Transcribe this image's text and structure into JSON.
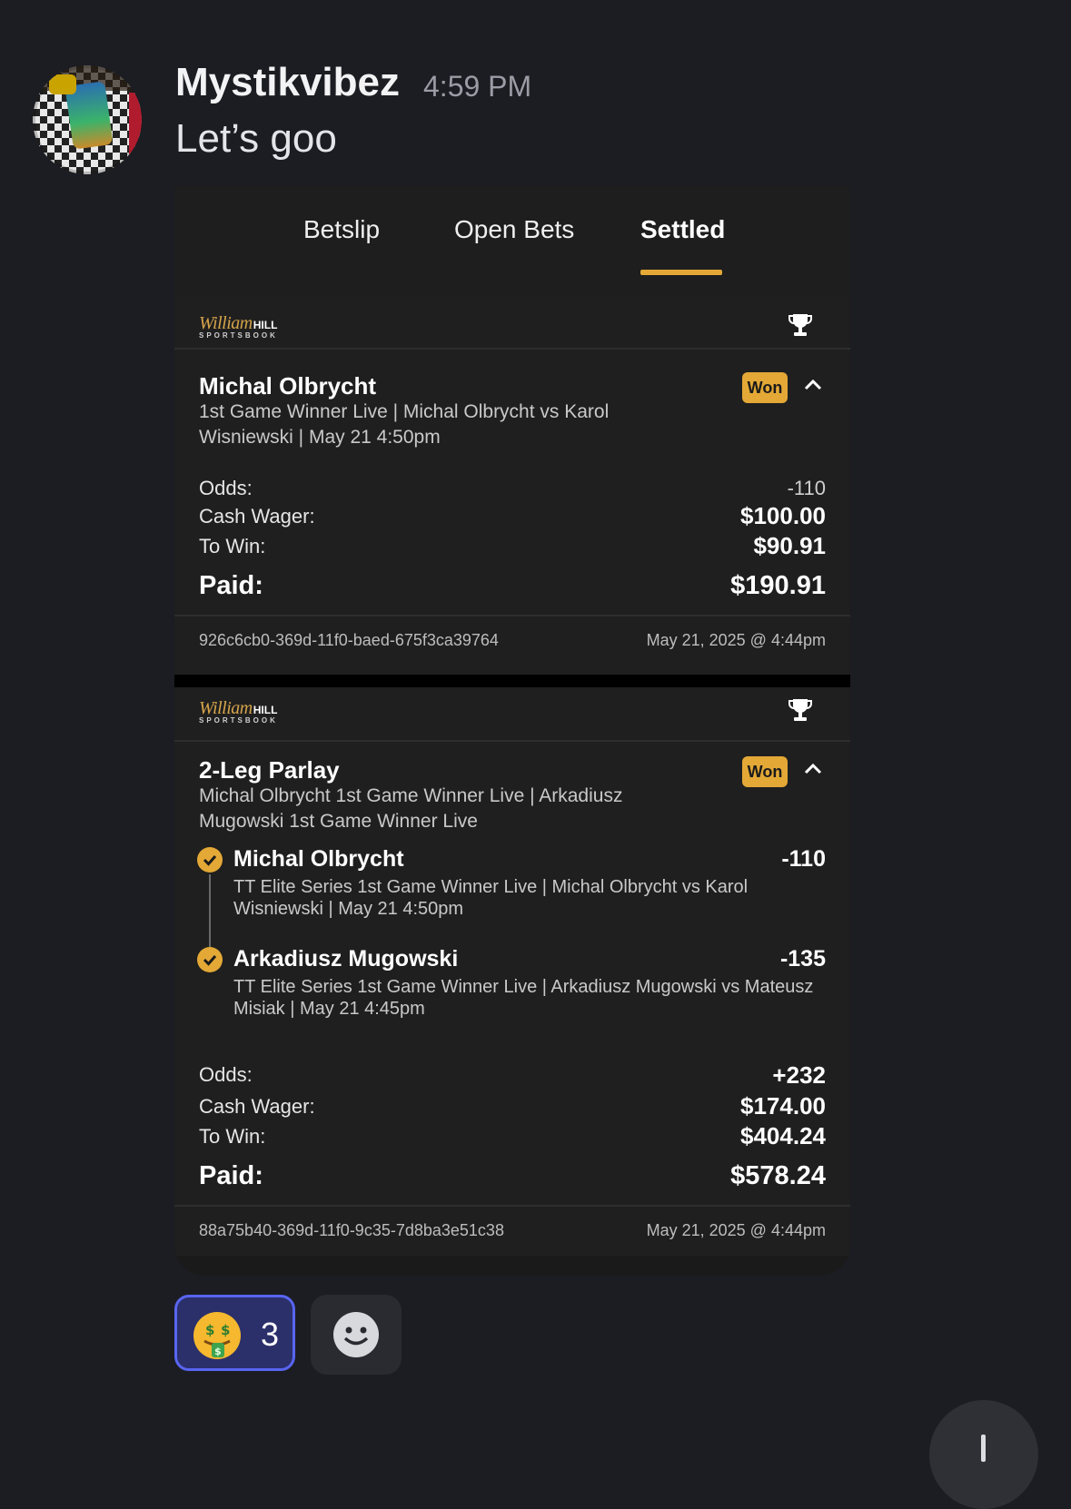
{
  "message": {
    "username": "Mystikvibez",
    "timestamp": "4:59 PM",
    "text": "Let’s goo"
  },
  "tabs": [
    {
      "label": "Betslip",
      "active": false
    },
    {
      "label": "Open Bets",
      "active": false
    },
    {
      "label": "Settled",
      "active": true
    }
  ],
  "brand": {
    "logo_text": "William HILL",
    "logo_sub": "SPORTSBOOK",
    "accent": "#e3a836"
  },
  "bets": [
    {
      "title": "Michal Olbrycht",
      "description": "1st Game Winner Live | Michal Olbrycht vs Karol Wisniewski | May 21 4:50pm",
      "status": "Won",
      "odds_label": "Odds:",
      "odds": "-110",
      "wager_label": "Cash Wager:",
      "wager": "$100.00",
      "towin_label": "To Win:",
      "towin": "$90.91",
      "paid_label": "Paid:",
      "paid": "$190.91",
      "id": "926c6cb0-369d-11f0-baed-675f3ca39764",
      "date": "May 21, 2025 @ 4:44pm"
    },
    {
      "title": "2-Leg Parlay",
      "description": "Michal Olbrycht 1st Game Winner Live | Arkadiusz Mugowski 1st Game Winner Live",
      "status": "Won",
      "legs": [
        {
          "name": "Michal Olbrycht",
          "odds": "-110",
          "desc": "TT Elite Series 1st Game Winner Live | Michal Olbrycht vs Karol Wisniewski | May 21 4:50pm"
        },
        {
          "name": "Arkadiusz Mugowski",
          "odds": "-135",
          "desc": "TT Elite Series 1st Game Winner Live | Arkadiusz Mugowski vs Mateusz Misiak | May 21 4:45pm"
        }
      ],
      "odds_label": "Odds:",
      "odds": "+232",
      "wager_label": "Cash Wager:",
      "wager": "$174.00",
      "towin_label": "To Win:",
      "towin": "$404.24",
      "paid_label": "Paid:",
      "paid": "$578.24",
      "id": "88a75b40-369d-11f0-9c35-7d8ba3e51c38",
      "date": "May 21, 2025 @ 4:44pm"
    }
  ],
  "reactions": [
    {
      "emoji": "money-mouth-face",
      "count": "3",
      "selected": true
    }
  ]
}
